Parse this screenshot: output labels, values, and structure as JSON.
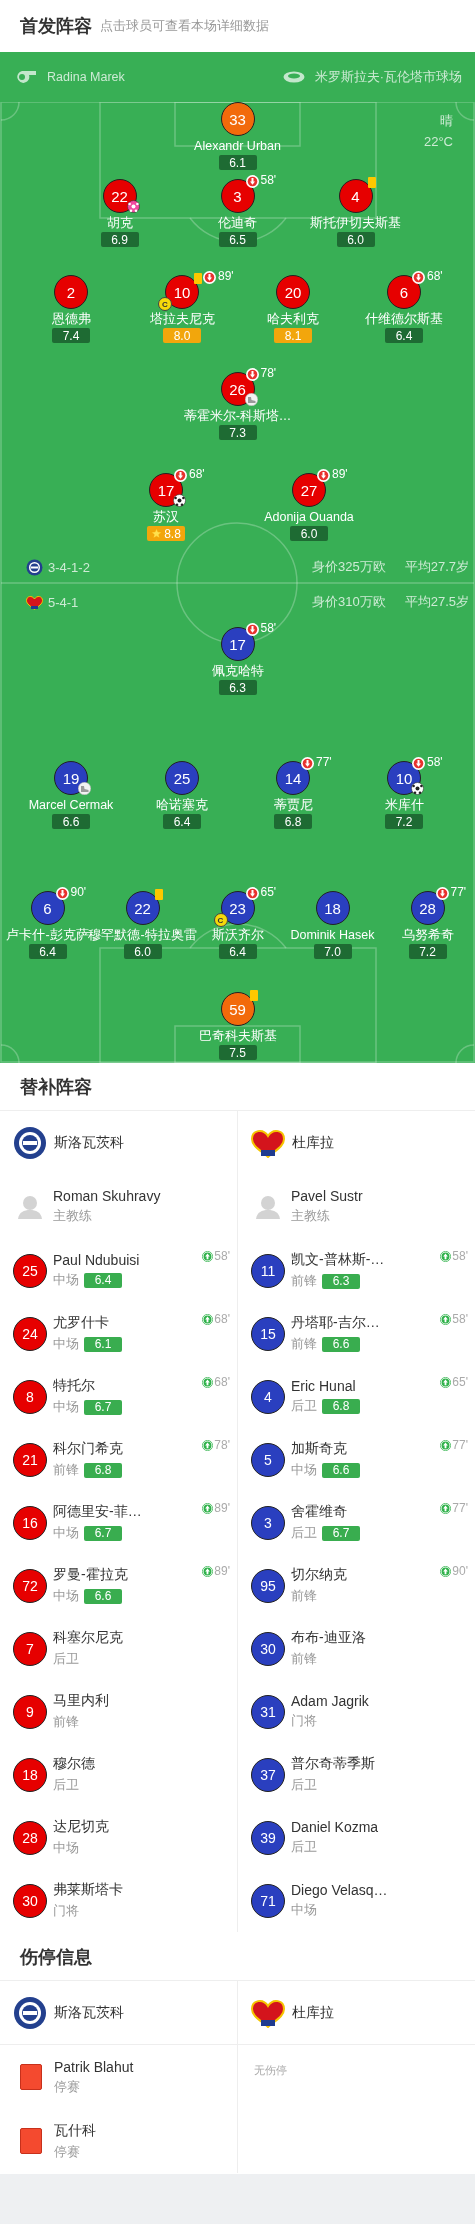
{
  "header": {
    "title": "首发阵容",
    "subtitle": "点击球员可查看本场详细数据"
  },
  "pitch": {
    "referee": "Radina Marek",
    "stadium": "米罗斯拉夫·瓦伦塔市球场",
    "weather": "晴",
    "temperature": "22°C",
    "home": {
      "formation": "3-4-1-2",
      "value": "身价325万欧",
      "avg_age": "平均27.7岁",
      "lines": [
        [
          {
            "number": "33",
            "name": "Alexandr Urban",
            "color": "#f26a0b",
            "rating": "6.1",
            "top_rated": false,
            "mvp": false,
            "yellow_card": false
          }
        ],
        [
          {
            "number": "22",
            "name": "胡克",
            "color": "#e60000",
            "rating": "6.9",
            "top_rated": false,
            "mvp": false,
            "yellow_card": false,
            "events": [
              {
                "kind": "own_goal"
              }
            ]
          },
          {
            "number": "3",
            "name": "伦迪奇",
            "color": "#e60000",
            "rating": "6.5",
            "top_rated": false,
            "mvp": false,
            "yellow_card": false,
            "sub_off": "58'"
          },
          {
            "number": "4",
            "name": "斯托伊切夫斯基",
            "color": "#e60000",
            "rating": "6.0",
            "top_rated": false,
            "mvp": false,
            "yellow_card": true
          }
        ],
        [
          {
            "number": "2",
            "name": "恩德弗",
            "color": "#e60000",
            "rating": "7.4",
            "top_rated": false,
            "mvp": false,
            "yellow_card": false
          },
          {
            "number": "10",
            "name": "塔拉夫尼克",
            "color": "#e60000",
            "rating": "8.0",
            "top_rated": true,
            "mvp": false,
            "yellow_card": true,
            "captain_mark": "C",
            "sub_off": "89'"
          },
          {
            "number": "20",
            "name": "哈夫利克",
            "color": "#e60000",
            "rating": "8.1",
            "top_rated": true,
            "mvp": false,
            "yellow_card": false
          },
          {
            "number": "6",
            "name": "什维德尔斯基",
            "color": "#e60000",
            "rating": "6.4",
            "top_rated": false,
            "mvp": false,
            "yellow_card": false,
            "sub_off": "68'"
          }
        ],
        [
          {
            "number": "26",
            "name": "蒂霍米尔-科斯塔…",
            "color": "#e60000",
            "rating": "7.3",
            "top_rated": false,
            "mvp": false,
            "yellow_card": false,
            "sub_off": "78'",
            "events": [
              {
                "kind": "assist"
              }
            ]
          }
        ],
        [
          {
            "number": "17",
            "name": "苏汉",
            "color": "#e60000",
            "rating": "8.8",
            "top_rated": true,
            "mvp": true,
            "yellow_card": false,
            "sub_off": "68'",
            "events": [
              {
                "kind": "goal"
              }
            ]
          },
          {
            "number": "27",
            "name": "Adonija Ouanda",
            "color": "#e60000",
            "rating": "6.0",
            "top_rated": false,
            "mvp": false,
            "yellow_card": false,
            "sub_off": "89'"
          }
        ]
      ]
    },
    "away": {
      "formation": "5-4-1",
      "value": "身价310万欧",
      "avg_age": "平均27.5岁",
      "lines": [
        [
          {
            "number": "17",
            "name": "佩克哈特",
            "color": "#2a3fbf",
            "rating": "6.3",
            "top_rated": false,
            "mvp": false,
            "yellow_card": false,
            "sub_off": "58'"
          }
        ],
        [
          {
            "number": "19",
            "name": "Marcel Cermak",
            "color": "#2a3fbf",
            "rating": "6.6",
            "top_rated": false,
            "mvp": false,
            "yellow_card": false,
            "events": [
              {
                "kind": "assist"
              }
            ]
          },
          {
            "number": "25",
            "name": "哈诺塞克",
            "color": "#2a3fbf",
            "rating": "6.4",
            "top_rated": false,
            "mvp": false,
            "yellow_card": false
          },
          {
            "number": "14",
            "name": "蒂贾尼",
            "color": "#2a3fbf",
            "rating": "6.8",
            "top_rated": false,
            "mvp": false,
            "yellow_card": false,
            "sub_off": "77'"
          },
          {
            "number": "10",
            "name": "米库什",
            "color": "#2a3fbf",
            "rating": "7.2",
            "top_rated": false,
            "mvp": false,
            "yellow_card": false,
            "sub_off": "58'",
            "events": [
              {
                "kind": "goal"
              }
            ]
          }
        ],
        [
          {
            "number": "6",
            "name": "卢卡什-彭克萨",
            "color": "#2a3fbf",
            "rating": "6.4",
            "top_rated": false,
            "mvp": false,
            "yellow_card": false,
            "sub_off": "90'"
          },
          {
            "number": "22",
            "name": "穆罕默德-特拉奥雷",
            "color": "#2a3fbf",
            "rating": "6.0",
            "top_rated": false,
            "mvp": false,
            "yellow_card": true
          },
          {
            "number": "23",
            "name": "斯沃齐尔",
            "color": "#2a3fbf",
            "rating": "6.4",
            "top_rated": false,
            "mvp": false,
            "yellow_card": false,
            "captain_mark": "C",
            "sub_off": "65'"
          },
          {
            "number": "18",
            "name": "Dominik Hasek",
            "color": "#2a3fbf",
            "rating": "7.0",
            "top_rated": false,
            "mvp": false,
            "yellow_card": false
          },
          {
            "number": "28",
            "name": "乌努希奇",
            "color": "#2a3fbf",
            "rating": "7.2",
            "top_rated": false,
            "mvp": false,
            "yellow_card": false,
            "sub_off": "77'"
          }
        ],
        [
          {
            "number": "59",
            "name": "巴奇科夫斯基",
            "color": "#f26a0b",
            "rating": "7.5",
            "top_rated": false,
            "mvp": false,
            "yellow_card": true
          }
        ]
      ]
    }
  },
  "subs": {
    "title": "替补阵容",
    "teams": [
      {
        "name": "斯洛瓦茨科",
        "color": "#e60000",
        "coach": "Roman Skuhravy",
        "coach_role": "主教练",
        "players": [
          {
            "number": "25",
            "name": "Paul Ndubuisi",
            "position": "中场",
            "rating": "6.4",
            "sub_in": "58'"
          },
          {
            "number": "24",
            "name": "尤罗什卡",
            "position": "中场",
            "rating": "6.1",
            "sub_in": "68'"
          },
          {
            "number": "8",
            "name": "特托尔",
            "position": "中场",
            "rating": "6.7",
            "sub_in": "68'"
          },
          {
            "number": "21",
            "name": "科尔门希克",
            "position": "前锋",
            "rating": "6.8",
            "sub_in": "78'"
          },
          {
            "number": "16",
            "name": "阿德里安-菲…",
            "position": "中场",
            "rating": "6.7",
            "sub_in": "89'"
          },
          {
            "number": "72",
            "name": "罗曼-霍拉克",
            "position": "中场",
            "rating": "6.6",
            "sub_in": "89'"
          },
          {
            "number": "7",
            "name": "科塞尔尼克",
            "position": "后卫"
          },
          {
            "number": "9",
            "name": "马里内利",
            "position": "前锋"
          },
          {
            "number": "18",
            "name": "穆尔德",
            "position": "后卫"
          },
          {
            "number": "28",
            "name": "达尼切克",
            "position": "中场"
          },
          {
            "number": "30",
            "name": "弗莱斯塔卡",
            "position": "门将"
          }
        ]
      },
      {
        "name": "杜库拉",
        "color": "#2a3fbf",
        "coach": "Pavel Sustr",
        "coach_role": "主教练",
        "players": [
          {
            "number": "11",
            "name": "凯文-普林斯-…",
            "position": "前锋",
            "rating": "6.3",
            "sub_in": "58'"
          },
          {
            "number": "15",
            "name": "丹塔耶-吉尔…",
            "position": "前锋",
            "rating": "6.6",
            "sub_in": "58'"
          },
          {
            "number": "4",
            "name": "Eric Hunal",
            "position": "后卫",
            "rating": "6.8",
            "sub_in": "65'"
          },
          {
            "number": "5",
            "name": "加斯奇克",
            "position": "中场",
            "rating": "6.6",
            "sub_in": "77'"
          },
          {
            "number": "3",
            "name": "舍霍维奇",
            "position": "后卫",
            "rating": "6.7",
            "sub_in": "77'"
          },
          {
            "number": "95",
            "name": "切尔纳克",
            "position": "前锋",
            "sub_in": "90'"
          },
          {
            "number": "30",
            "name": "布布-迪亚洛",
            "position": "前锋"
          },
          {
            "number": "31",
            "name": "Adam Jagrik",
            "position": "门将"
          },
          {
            "number": "37",
            "name": "普尔奇蒂季斯",
            "position": "后卫"
          },
          {
            "number": "39",
            "name": "Daniel Kozma",
            "position": "后卫"
          },
          {
            "number": "71",
            "name": "Diego Velasq…",
            "position": "中场"
          }
        ]
      }
    ]
  },
  "injuries": {
    "title": "伤停信息",
    "teams": [
      {
        "name": "斯洛瓦茨科",
        "players": [
          {
            "name": "Patrik Blahut",
            "reason": "停赛"
          },
          {
            "name": "瓦什科",
            "reason": "停赛"
          }
        ]
      },
      {
        "name": "杜库拉",
        "note": "无伤停"
      }
    ]
  }
}
